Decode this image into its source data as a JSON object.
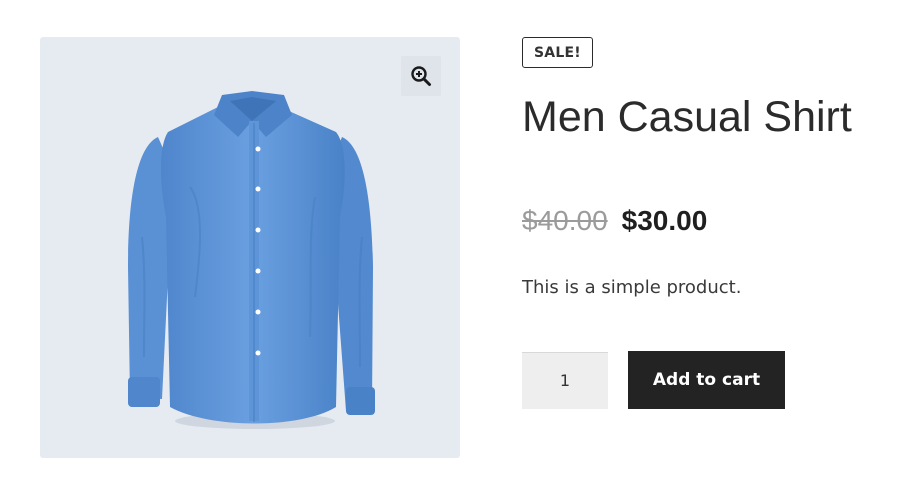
{
  "product": {
    "sale_badge": "SALE!",
    "title": "Men Casual Shirt",
    "price_regular": "$40.00",
    "price_sale": "$30.00",
    "short_description": "This is a simple product.",
    "quantity": "1",
    "add_to_cart_label": "Add to cart",
    "image_name": "blue-casual-shirt-image",
    "zoom_icon": "zoom-in-icon"
  },
  "colors": {
    "gallery_background": "#e6ebf2",
    "shirt_blue": "#5b93d6",
    "button_background": "#232323",
    "old_price": "#9b9b9b"
  }
}
